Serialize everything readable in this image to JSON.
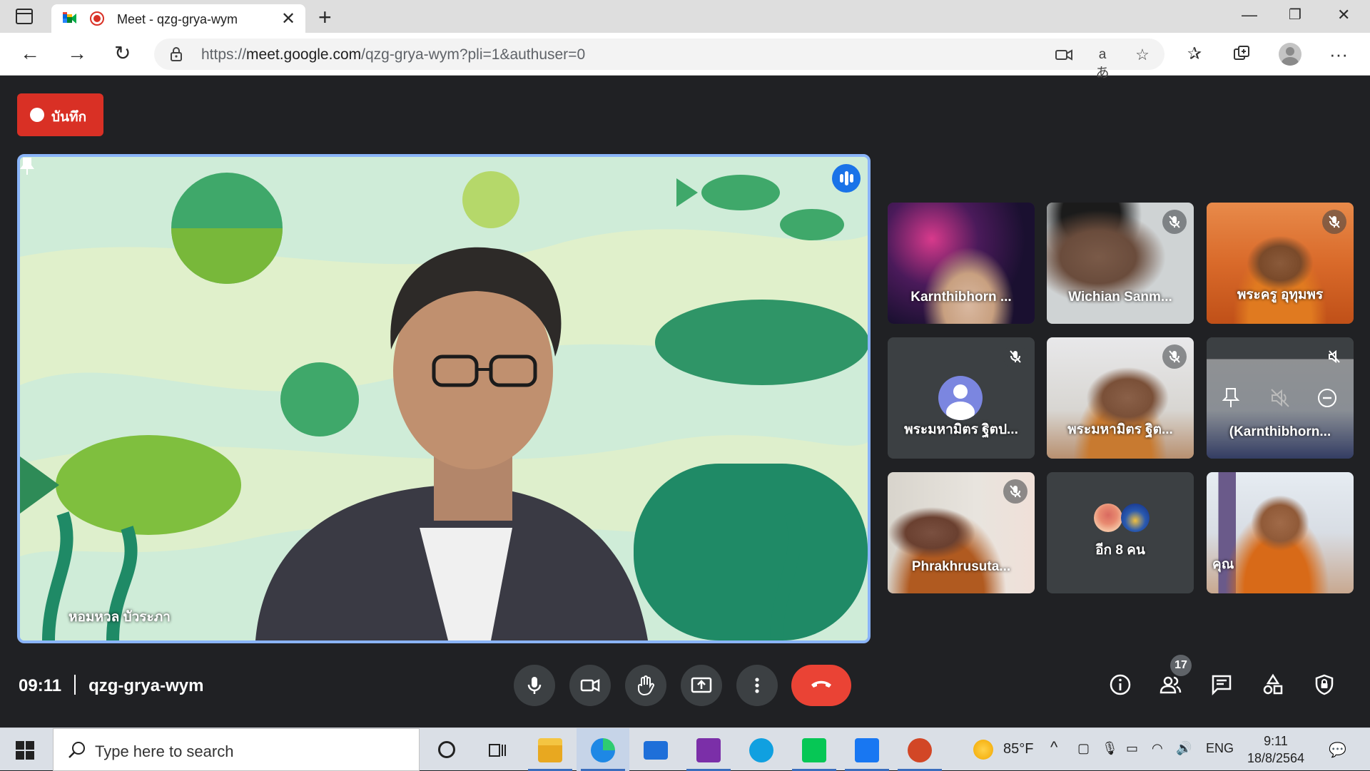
{
  "browser": {
    "tab_title": "Meet - qzg-grya-wym",
    "url_prefix": "https://",
    "url_host": "meet.google.com",
    "url_path": "/qzg-grya-wym?pli=1&authuser=0"
  },
  "meet": {
    "record_label": "บันทึก",
    "main_speaker": "หอมหวล บัวระภา",
    "time": "09:11",
    "meeting_code": "qzg-grya-wym",
    "people_count": "17",
    "participants": [
      {
        "name": "Karnthibhorn ..."
      },
      {
        "name": "Wichian Sanm..."
      },
      {
        "name": "พระครู อุทุมพร"
      },
      {
        "name": "พระมหามิตร ฐิตป..."
      },
      {
        "name": "พระมหามิตร ฐิต..."
      },
      {
        "name": "(Karnthibhorn..."
      },
      {
        "name": "Phrakhrusuta..."
      },
      {
        "name": "อีก 8 คน"
      },
      {
        "name": "คุณ"
      }
    ],
    "colors": {
      "record": "#d93025",
      "end_call": "#ea4335",
      "speaker_border": "#8ab4f8",
      "background": "#202124"
    }
  },
  "taskbar": {
    "search_placeholder": "Type here to search",
    "weather": "85°F",
    "language": "ENG",
    "time": "9:11",
    "date": "18/8/2564"
  }
}
